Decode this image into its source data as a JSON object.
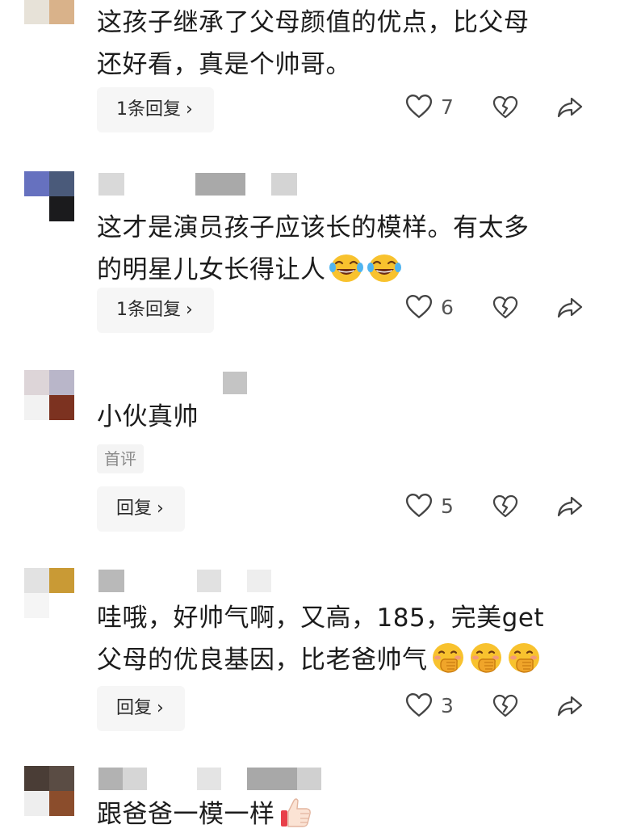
{
  "comments": [
    {
      "lines": [
        "这孩子继承了父母颜值的优点，比父母",
        "还好看，真是个帅哥。"
      ],
      "reply_label": "1条回复",
      "likes": "7"
    },
    {
      "lines": [
        "这才是演员孩子应该长的模样。有太多",
        "的明星儿女长得让人"
      ],
      "emojis": [
        "laughing-crying-emoji",
        "laughing-crying-emoji"
      ],
      "reply_label": "1条回复",
      "likes": "6"
    },
    {
      "lines": [
        "小伙真帅"
      ],
      "badge": "首评",
      "reply_label": "回复",
      "likes": "5"
    },
    {
      "lines": [
        "哇哦，好帅气啊，又高，185，完美get",
        "父母的优良基因，比老爸帅气"
      ],
      "emojis": [
        "hand-over-mouth-emoji",
        "hand-over-mouth-emoji",
        "hand-over-mouth-emoji"
      ],
      "reply_label": "回复",
      "likes": "3"
    },
    {
      "lines": [
        "跟爸爸一模一样"
      ],
      "emojis": [
        "thumbs-up-emoji"
      ]
    }
  ],
  "icons": {
    "chevron": "chevron-right-icon",
    "like": "heart-outline-icon",
    "dislike": "broken-heart-icon",
    "share": "share-arrow-icon"
  }
}
